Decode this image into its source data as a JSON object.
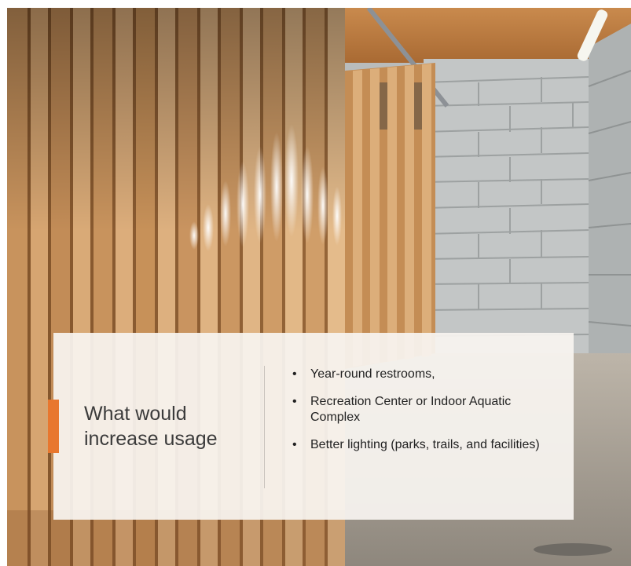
{
  "slide": {
    "title": "What would increase usage",
    "accent_color": "#e8772e",
    "bullet_glyph": "•",
    "bullets": [
      "Year-round restrooms,",
      "Recreation Center or Indoor Aquatic Complex",
      "Better lighting (parks, trails, and facilities)"
    ]
  },
  "background": {
    "subject": "photo of wooden slatted restroom stalls with cinder block wall"
  }
}
